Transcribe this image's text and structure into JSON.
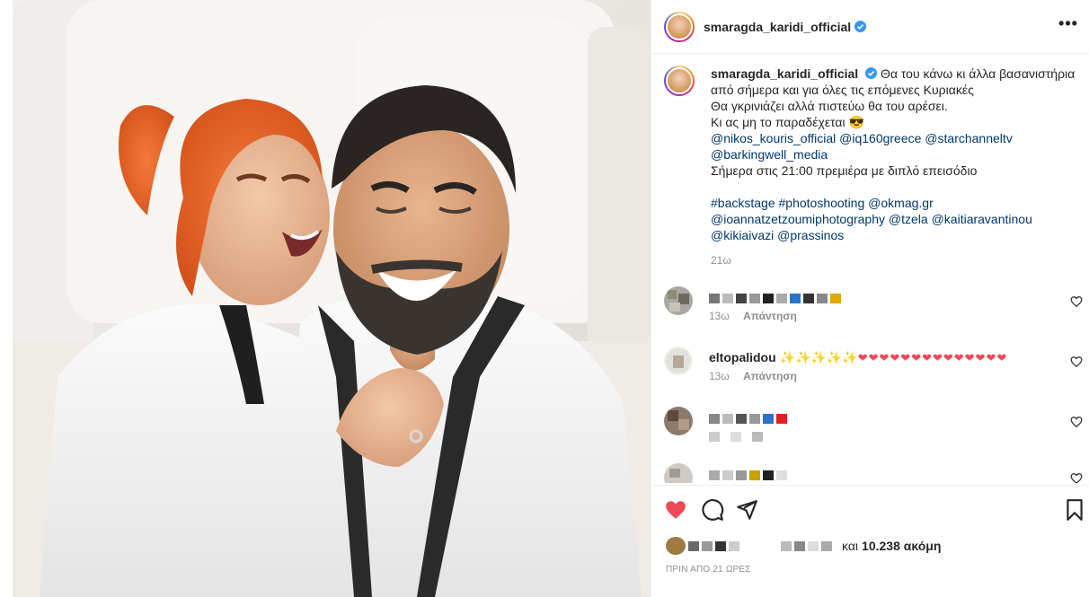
{
  "post": {
    "username": "smaragda_karidi_official",
    "more_glyph": "•••",
    "caption": {
      "lines": [
        "Θα του κάνω κι άλλα βασανιστήρια",
        "από σήμερα και για όλες τις επόμενες Κυριακές",
        "Θα γκρινιάζει αλλά πιστεύω θα του αρέσει.",
        "Κι ας μη το παραδέχεται 😎"
      ],
      "mentions_1": [
        "@nikos_kouris_official",
        "@iq160greece",
        "@starchanneltv"
      ],
      "mentions_2": "@barkingwell_media",
      "premiere": "Σήμερα στις 21:00 πρεμιέρα με διπλό επεισόδιο",
      "tags_1": [
        "#backstage",
        "#photoshooting",
        "@okmag.gr"
      ],
      "tags_2": [
        "@ioannatzetzoumiphotography",
        "@tzela",
        "@kaitiaravantinou"
      ],
      "tags_3": [
        "@kikiaivazi",
        "@prassinos"
      ],
      "time": "21ω"
    },
    "comments": [
      {
        "username": "",
        "text": "",
        "time": "13ω",
        "reply": "Απάντηση"
      },
      {
        "username": "eltopalidou",
        "sparkles": "✨✨✨✨✨",
        "hearts": "❤❤❤❤❤❤❤❤❤❤❤❤❤❤",
        "time": "13ω",
        "reply": "Απάντηση"
      },
      {
        "username": "",
        "text": "",
        "time": "",
        "reply": ""
      },
      {
        "username": "",
        "text": "",
        "time": "",
        "reply": ""
      }
    ],
    "likes_text": "και",
    "likes_count": "10.238 ακόμη",
    "posted_ago": "ΠΡΙΝ ΑΠΟ 21 ΩΡΕΣ"
  },
  "colors": {
    "verified": "#3897f0",
    "heart_liked": "#ed4956",
    "mention": "#00376b",
    "muted": "#8e8e8e"
  },
  "icons": {
    "like": "heart-filled-icon",
    "comment": "speech-bubble-icon",
    "share": "paper-plane-icon",
    "save": "bookmark-icon",
    "comment_like": "heart-outline-icon",
    "verified": "verified-badge-icon",
    "more": "ellipsis-icon"
  }
}
